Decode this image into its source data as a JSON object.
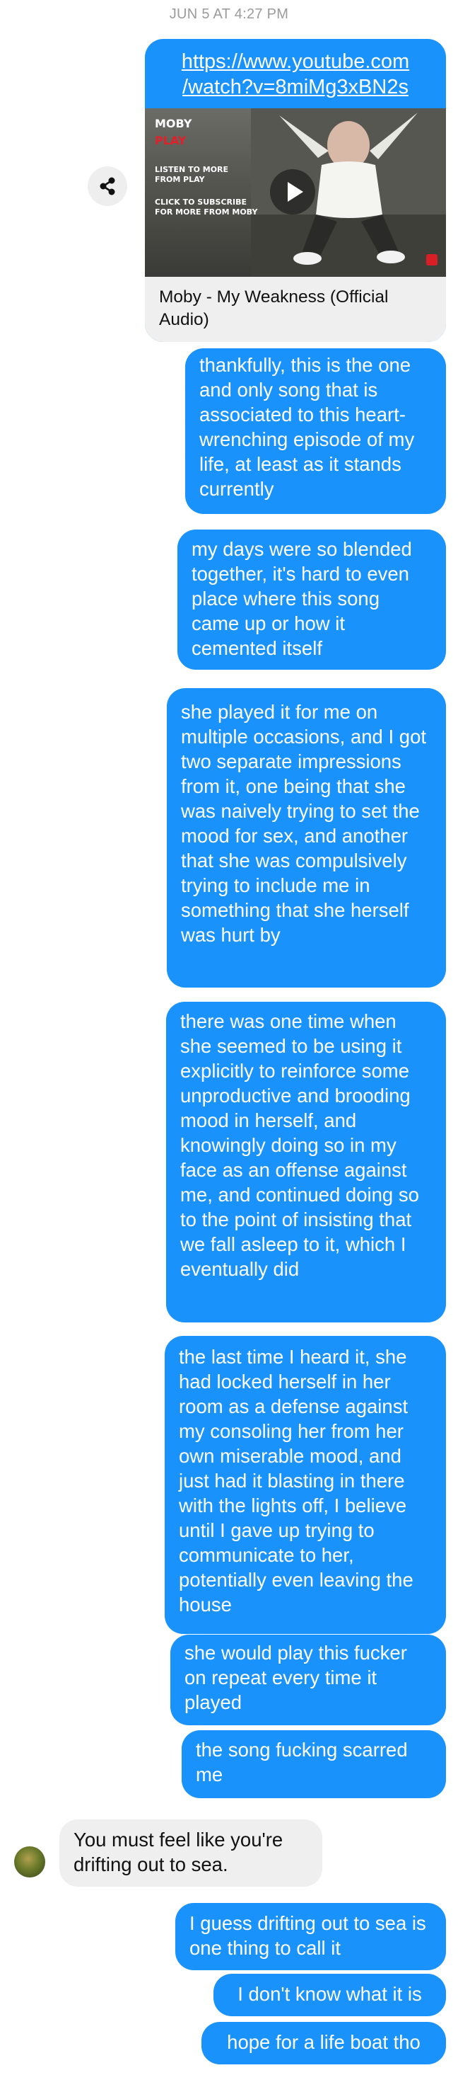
{
  "timestamp": "JUN 5 AT 4:27 PM",
  "link_card": {
    "url_line1": "https://www.youtube.com",
    "url_line2": "/watch?v=8miMg3xBN2s",
    "thumbnail": {
      "title": "MOBY",
      "subtitle": "PLAY",
      "line1": "LISTEN TO MORE",
      "line2": "FROM PLAY",
      "line3": "CLICK TO SUBSCRIBE",
      "line4": "FOR MORE FROM MOBY"
    },
    "caption": "Moby - My Weakness (Official Audio)"
  },
  "messages": [
    {
      "direction": "out",
      "text": "thankfully, this is the one and only song that is associated to this heart-wrenching episode of my life, at least as it stands currently"
    },
    {
      "direction": "out",
      "text": "my days were so blended together, it's hard to even place where this song came up or how it cemented itself"
    },
    {
      "direction": "out",
      "text": "she played it for me on multiple occasions, and I got two separate impressions from it, one being that she was naively trying to set the mood for sex, and another that she was compulsively trying to include me in something that she herself was hurt by"
    },
    {
      "direction": "out",
      "text": "there was one time when she seemed to be using it explicitly to reinforce some unproductive and brooding mood in herself, and knowingly doing so in my face as an offense against me, and continued doing so to the point of insisting that we fall asleep to it, which I eventually did"
    },
    {
      "direction": "out",
      "text": "the last time I heard it, she had locked herself in her room as a defense against my consoling her from her own miserable mood, and just had it blasting in there with the lights off, I believe until I gave up trying to communicate to her, potentially even leaving the house"
    },
    {
      "direction": "out",
      "text": "she would play this fucker on repeat every time it played"
    },
    {
      "direction": "out",
      "text": "the song fucking scarred me"
    },
    {
      "direction": "in",
      "text": "You must feel like you're drifting out to sea."
    },
    {
      "direction": "out",
      "text": "I guess drifting out to sea is one thing to call it"
    },
    {
      "direction": "out",
      "text": "I don't know what it is"
    },
    {
      "direction": "out",
      "text": "hope for a life boat tho"
    }
  ]
}
